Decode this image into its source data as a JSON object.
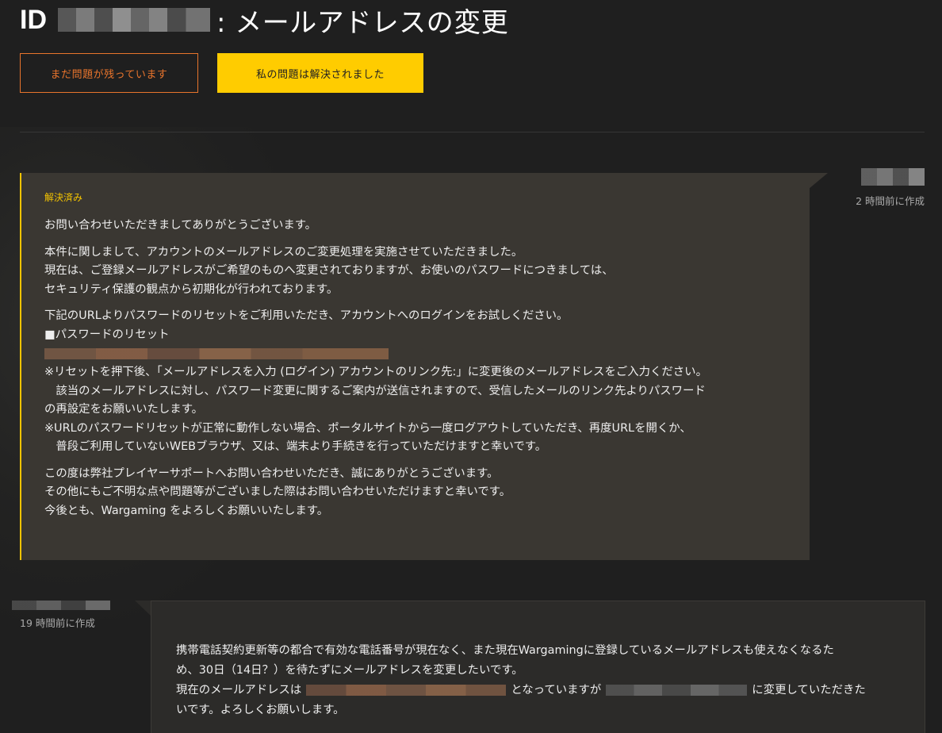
{
  "header": {
    "title_prefix": "ID",
    "title_suffix": ": メールアドレスの変更"
  },
  "actions": {
    "unresolved_label": "まだ問題が残っています",
    "resolved_label": "私の問題は解決されました"
  },
  "messages": [
    {
      "author": "staff",
      "status": "解決済み",
      "time": "2 時間前に作成",
      "paragraphs": [
        [
          "お問い合わせいただきましてありがとうございます。"
        ],
        [
          "本件に関しまして、アカウントのメールアドレスのご変更処理を実施させていただきました。",
          "現在は、ご登録メールアドレスがご希望のものへ変更されておりますが、お使いのパスワードにつきましては、",
          "セキュリティ保護の観点から初期化が行われております。"
        ],
        [
          "下記のURLよりパスワードのリセットをご利用いただき、アカウントへのログインをお試しください。",
          "■パスワードのリセット"
        ],
        [
          "※リセットを押下後、「メールアドレスを入力 (ログイン) アカウントのリンク先:」に変更後のメールアドレスをご入力ください。",
          "　該当のメールアドレスに対し、パスワード変更に関するご案内が送信されますので、受信したメールのリンク先よりパスワード",
          "の再設定をお願いいたします。",
          "※URLのパスワードリセットが正常に動作しない場合、ポータルサイトから一度ログアウトしていただき、再度URLを開くか、",
          "　普段ご利用していないWEBブラウザ、又は、端末より手続きを行っていただけますと幸いです。"
        ],
        [
          "この度は弊社プレイヤーサポートへお問い合わせいただき、誠にありがとうございます。",
          "その他にもご不明な点や問題等がございました際はお問い合わせいただけますと幸いです。",
          "今後とも、Wargaming をよろしくお願いいたします。"
        ]
      ]
    },
    {
      "author": "user",
      "time": "19 時間前に作成",
      "lines": [
        "携帯電話契約更新等の都合で有効な電話番号が現在なく、また現在Wargamingに登録しているメールアドレスも使えなくなるた",
        "め、30日（14日？）を待たずにメールアドレスを変更したいです。",
        "現在のメールアドレスは",
        "となっていますが",
        "に変更していただきた",
        "いです。よろしくお願いします。"
      ]
    }
  ]
}
